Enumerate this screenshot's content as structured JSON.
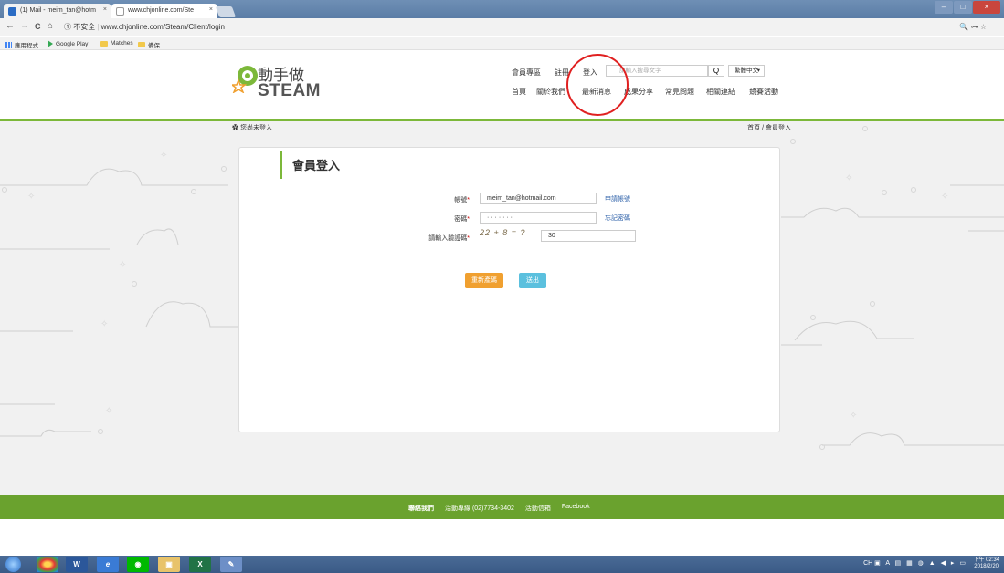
{
  "browser": {
    "tabs": [
      {
        "label": "(1) Mail - meim_tan@hotm",
        "close": "×"
      },
      {
        "label": "www.chjonline.com/Ste",
        "close": "×"
      }
    ],
    "window_controls": [
      "–",
      "□",
      "×"
    ],
    "nav": {
      "back": "←",
      "forward": "→",
      "reload": "C",
      "home": "⌂"
    },
    "security": "① 不安全",
    "url": "www.chjonline.com/Steam/Client/login",
    "address_right_icons": "🔍 ⊶ ☆",
    "bookmarks": [
      {
        "label": "應用程式",
        "icon": "apps-icon"
      },
      {
        "label": "Google Play",
        "icon": "play-icon"
      },
      {
        "label": "Matches",
        "icon": "folder-icon"
      },
      {
        "label": "備保",
        "icon": "folder-icon"
      }
    ]
  },
  "site": {
    "logo_line1": "動手做",
    "logo_line2": "STEAM",
    "top_links": {
      "member": "會員專區",
      "register": "註冊",
      "login": "登入"
    },
    "search_placeholder": "請輸入搜尋文字",
    "search_button": "Q",
    "language": "繁體中文",
    "nav": [
      "首頁",
      "關於我們",
      "最新消息",
      "成果分享",
      "常見問題",
      "相關連結",
      "競賽活動"
    ],
    "login_status": "您尚未登入",
    "breadcrumb": "首頁 / 會員登入"
  },
  "login": {
    "title": "會員登入",
    "account_label": "帳號",
    "account_value": "meim_tan@hotmail.com",
    "apply_link": "申請帳號",
    "password_label": "密碼",
    "password_value": "· · · · · · ·",
    "forgot_link": "忘記密碼",
    "captcha_label": "請輸入驗證碼",
    "captcha_image_text": "22 + 8 = ?",
    "captcha_value": "30",
    "reset_button": "重新產碼",
    "submit_button": "送出"
  },
  "footer": {
    "items": [
      "聯絡我們",
      "活動專線 (02)7734-3402",
      "活動信箱",
      "Facebook"
    ]
  },
  "taskbar": {
    "apps": [
      "Chrome",
      "Word",
      "IE",
      "LINE",
      "Explorer",
      "Excel",
      "Paint"
    ],
    "tray": "CH",
    "time": "下午 02:34",
    "date": "2018/2/20"
  },
  "colors": {
    "accent_green": "#7cb83a",
    "footer_green": "#6aa22e",
    "orange_button": "#f0a030",
    "blue_button": "#5bc0de",
    "annotation_red": "#e02020"
  }
}
